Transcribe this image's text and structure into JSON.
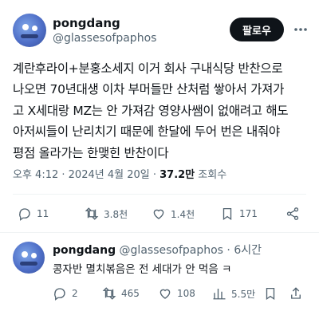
{
  "main_post": {
    "display_name": "pongdang",
    "handle": "@glassesofpaphos",
    "follow_label": "팔로우",
    "text": "계란후라이+분홍소세지 이거 회사 구내식당 반찬으로\n나오면 70년대생 이차 부머들만 산처럼 쌓아서 가져가\n고 X세대랑 MZ는 안 가져감 영양사쌤이 없애려고 해도\n아저씨들이 난리치기 때문에 한달에 두어 번은 내줘야\n평점 올라가는 한맺힌 반찬이다",
    "time": "오후 4:12",
    "sep1": " · ",
    "date": "2024년 4월 20일",
    "sep2": " · ",
    "views": "37.2만",
    "views_label": " 조회수",
    "actions": {
      "reply": "11",
      "repost": "3.8천",
      "like": "1.4천",
      "bookmark": "171"
    }
  },
  "reply_post": {
    "display_name": "pongdang",
    "handle": "@glassesofpaphos",
    "sep": " · ",
    "time_ago": "6시간",
    "text": "콩자반 멸치볶음은 전 세대가 안 먹음 ㅋ",
    "actions": {
      "reply": "2",
      "repost": "465",
      "like": "108",
      "views": "5.5만"
    }
  },
  "colors": {
    "text": "#0f1419",
    "secondary": "#536471",
    "follow_bg": "#0f1419",
    "avatar": "#4f6fc8"
  }
}
